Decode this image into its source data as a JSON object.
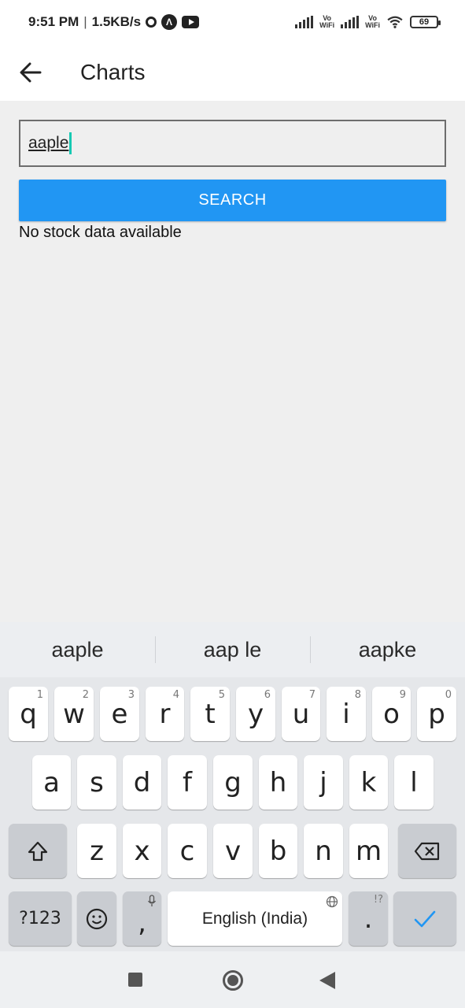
{
  "status_bar": {
    "time": "9:51 PM",
    "separator": "|",
    "network_speed": "1.5KB/s",
    "vowifi_label_1": "Vo\nWiFi",
    "vowifi_label_2": "Vo\nWiFi",
    "battery": "69",
    "icons": [
      "sync-icon",
      "arc-icon",
      "youtube-icon",
      "signal-icon",
      "vowifi-icon",
      "signal-icon",
      "vowifi-icon",
      "wifi-icon",
      "battery-icon"
    ]
  },
  "app_bar": {
    "back_icon": "arrow-left-icon",
    "title": "Charts"
  },
  "search": {
    "value": "aaple",
    "button_label": "SEARCH"
  },
  "message": "No stock data available",
  "suggestions": [
    "aaple",
    "aap le",
    "aapke"
  ],
  "keyboard": {
    "row1": [
      {
        "key": "q",
        "hint": "1"
      },
      {
        "key": "w",
        "hint": "2"
      },
      {
        "key": "e",
        "hint": "3"
      },
      {
        "key": "r",
        "hint": "4"
      },
      {
        "key": "t",
        "hint": "5"
      },
      {
        "key": "y",
        "hint": "6"
      },
      {
        "key": "u",
        "hint": "7"
      },
      {
        "key": "i",
        "hint": "8"
      },
      {
        "key": "o",
        "hint": "9"
      },
      {
        "key": "p",
        "hint": "0"
      }
    ],
    "row2": [
      "a",
      "s",
      "d",
      "f",
      "g",
      "h",
      "j",
      "k",
      "l"
    ],
    "row3": [
      "z",
      "x",
      "c",
      "v",
      "b",
      "n",
      "m"
    ],
    "symbols_label": "?123",
    "comma": ",",
    "space_label": "English (India)",
    "period": ".",
    "period_hint": "!?",
    "accent_color": "#2196f3"
  },
  "colors": {
    "button": "#2196f3",
    "caret": "#16c9b3",
    "background": "#efefef"
  }
}
